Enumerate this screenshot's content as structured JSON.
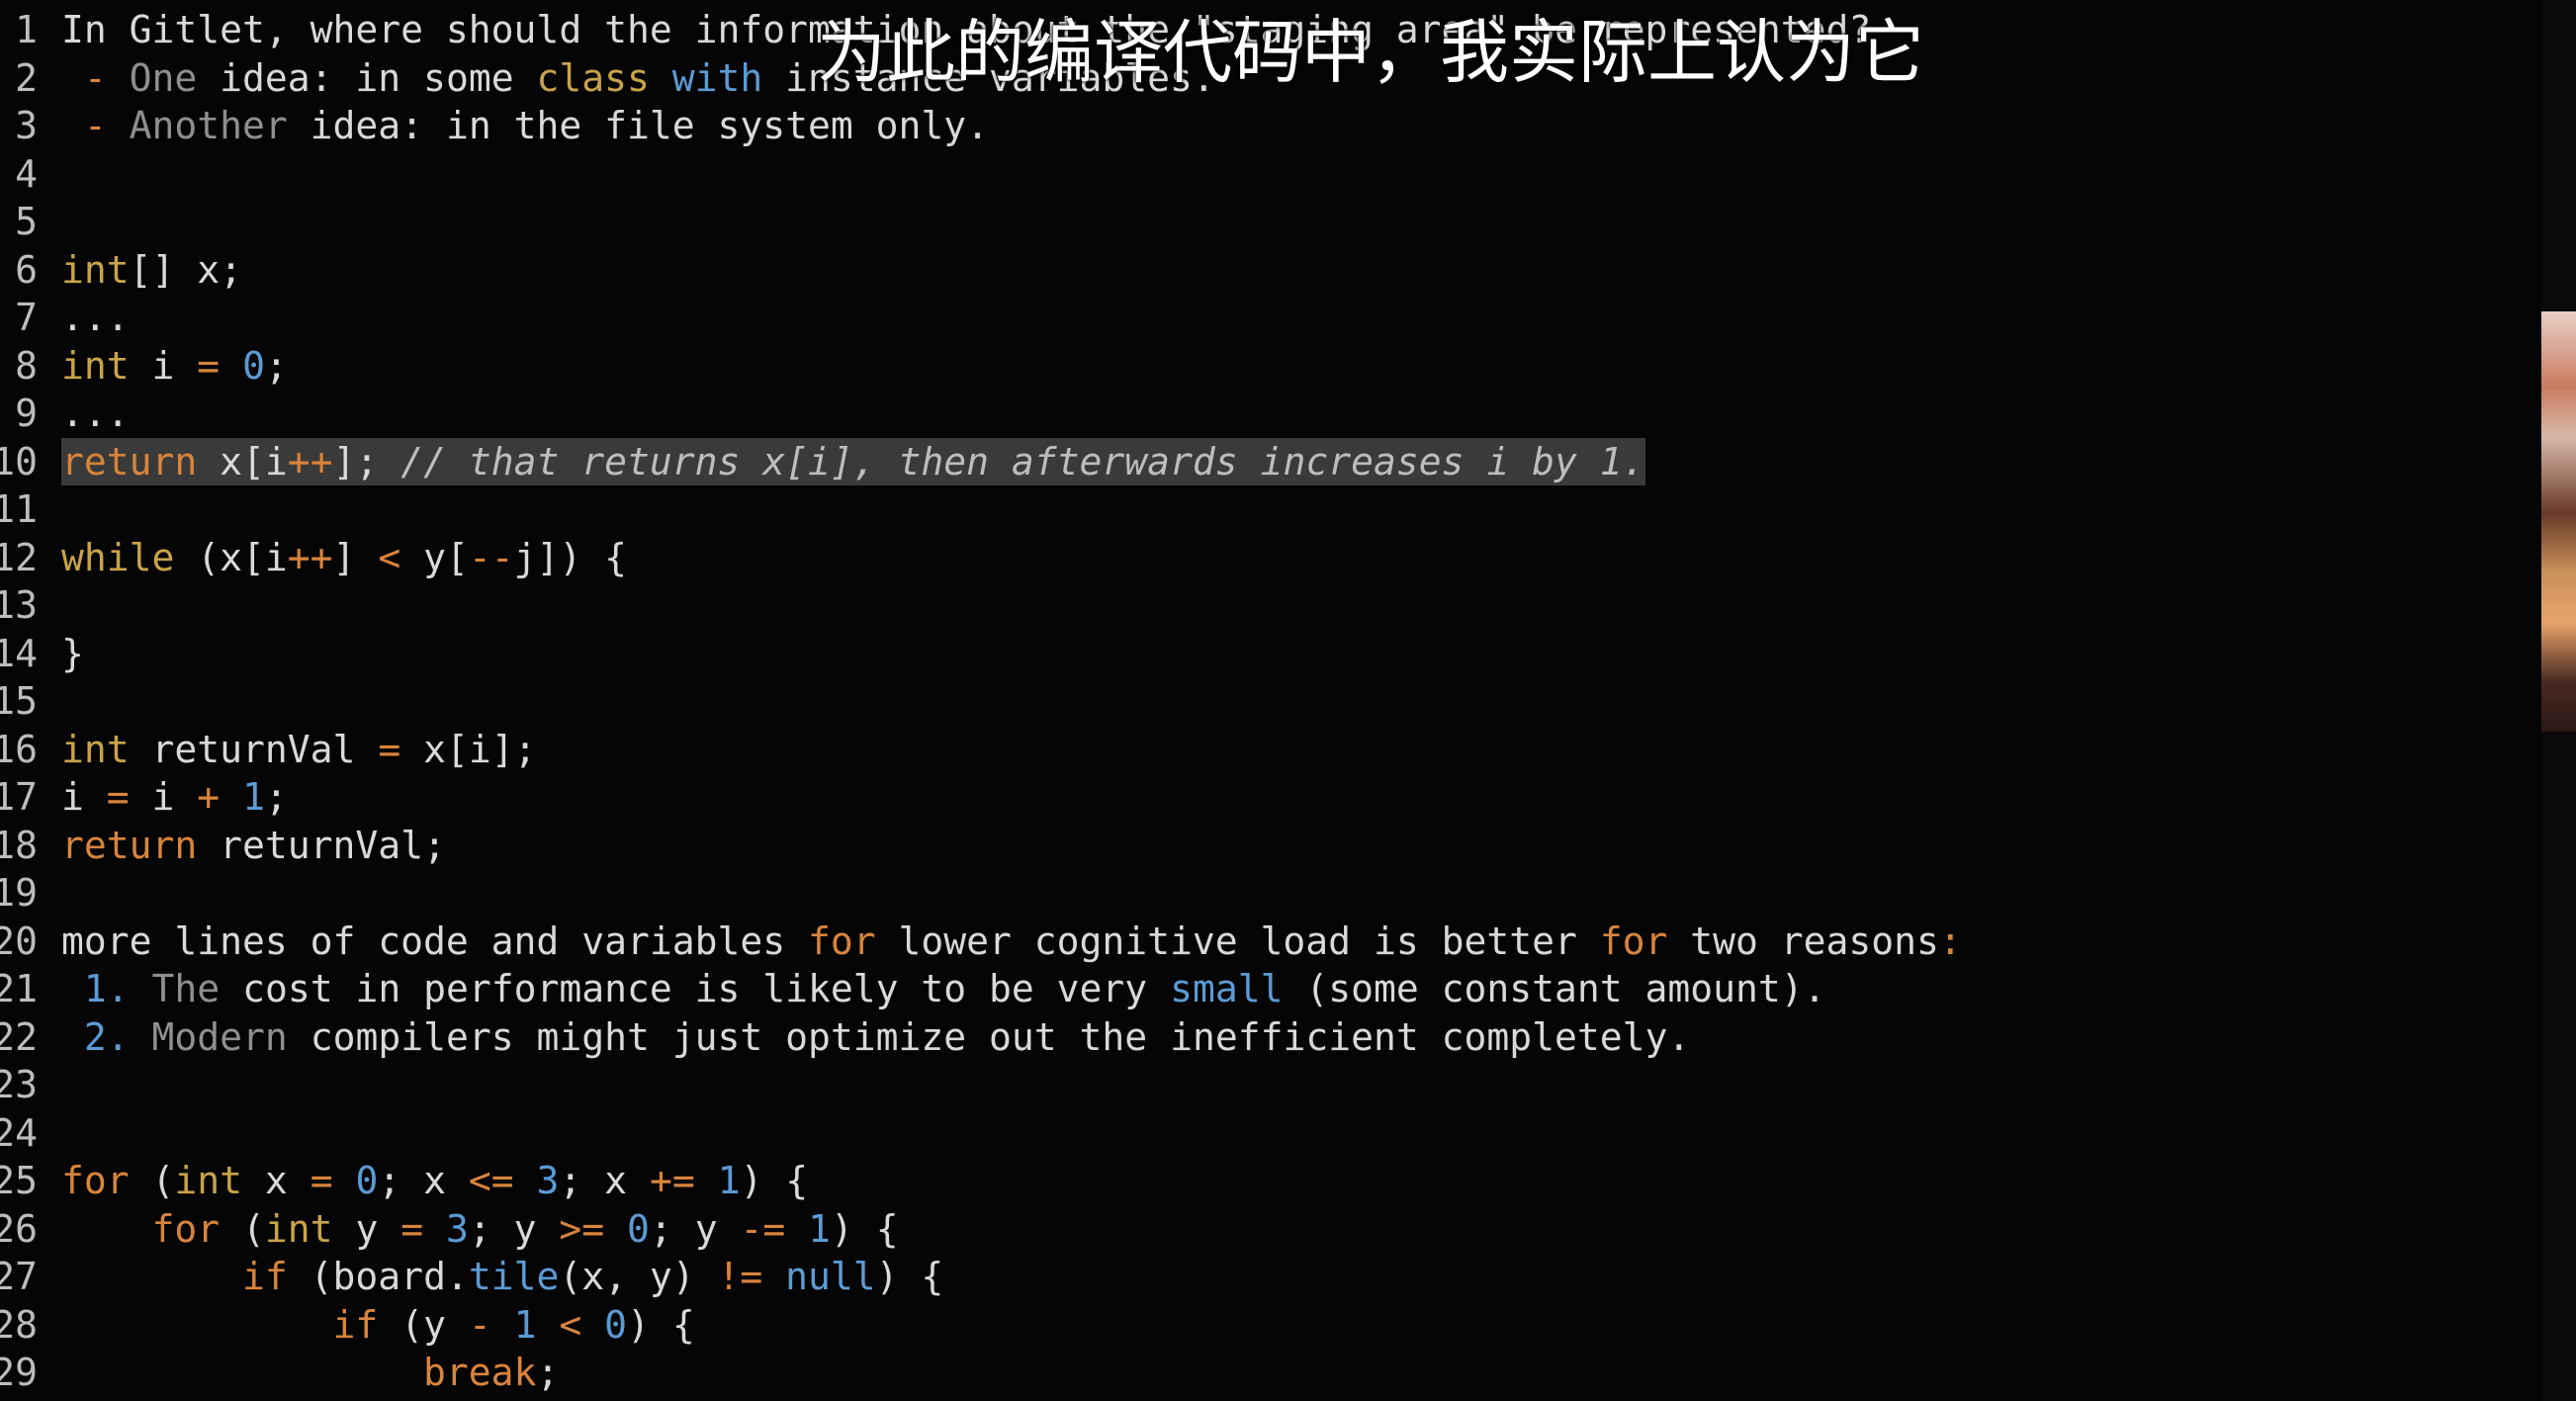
{
  "subtitle": "为此的编译代码中，我实际上认为它",
  "lines": [
    {
      "n": "1",
      "tokens": [
        {
          "t": "In Gitlet, where should the information about the \"staging area\" be represented?",
          "c": "def"
        }
      ]
    },
    {
      "n": "2",
      "tokens": [
        {
          "t": " - ",
          "c": "op"
        },
        {
          "t": "One",
          "c": "dim"
        },
        {
          "t": " idea: in some ",
          "c": "def"
        },
        {
          "t": "class",
          "c": "kw2"
        },
        {
          "t": " ",
          "c": "def"
        },
        {
          "t": "with",
          "c": "blue"
        },
        {
          "t": " instance variables.",
          "c": "def"
        }
      ]
    },
    {
      "n": "3",
      "tokens": [
        {
          "t": " - ",
          "c": "op"
        },
        {
          "t": "Another",
          "c": "dim"
        },
        {
          "t": " idea: in the file system only.",
          "c": "def"
        }
      ]
    },
    {
      "n": "4",
      "tokens": []
    },
    {
      "n": "5",
      "tokens": []
    },
    {
      "n": "6",
      "tokens": [
        {
          "t": "int",
          "c": "kw2"
        },
        {
          "t": "[] x;",
          "c": "def"
        }
      ]
    },
    {
      "n": "7",
      "tokens": [
        {
          "t": "...",
          "c": "def"
        }
      ]
    },
    {
      "n": "8",
      "tokens": [
        {
          "t": "int",
          "c": "kw2"
        },
        {
          "t": " i ",
          "c": "def"
        },
        {
          "t": "=",
          "c": "op"
        },
        {
          "t": " ",
          "c": "def"
        },
        {
          "t": "0",
          "c": "num"
        },
        {
          "t": ";",
          "c": "def"
        }
      ]
    },
    {
      "n": "9",
      "tokens": [
        {
          "t": "...",
          "c": "def"
        }
      ]
    },
    {
      "n": "10",
      "hl": true,
      "tokens": [
        {
          "t": "return",
          "c": "kw"
        },
        {
          "t": " x[i",
          "c": "def"
        },
        {
          "t": "++",
          "c": "op"
        },
        {
          "t": "]; ",
          "c": "def"
        },
        {
          "t": "// that returns x[i], then afterwards increases i by 1.",
          "c": "com"
        }
      ]
    },
    {
      "n": "11",
      "tokens": []
    },
    {
      "n": "12",
      "tokens": [
        {
          "t": "while",
          "c": "kw2"
        },
        {
          "t": " (x[i",
          "c": "def"
        },
        {
          "t": "++",
          "c": "op"
        },
        {
          "t": "] ",
          "c": "def"
        },
        {
          "t": "<",
          "c": "op"
        },
        {
          "t": " y[",
          "c": "def"
        },
        {
          "t": "--",
          "c": "op"
        },
        {
          "t": "j]) {",
          "c": "def"
        }
      ]
    },
    {
      "n": "13",
      "tokens": []
    },
    {
      "n": "14",
      "tokens": [
        {
          "t": "}",
          "c": "def"
        }
      ]
    },
    {
      "n": "15",
      "tokens": []
    },
    {
      "n": "16",
      "tokens": [
        {
          "t": "int",
          "c": "kw2"
        },
        {
          "t": " returnVal ",
          "c": "def"
        },
        {
          "t": "=",
          "c": "op"
        },
        {
          "t": " x[i];",
          "c": "def"
        }
      ]
    },
    {
      "n": "17",
      "tokens": [
        {
          "t": "i ",
          "c": "def"
        },
        {
          "t": "=",
          "c": "op"
        },
        {
          "t": " i ",
          "c": "def"
        },
        {
          "t": "+",
          "c": "op"
        },
        {
          "t": " ",
          "c": "def"
        },
        {
          "t": "1",
          "c": "num"
        },
        {
          "t": ";",
          "c": "def"
        }
      ]
    },
    {
      "n": "18",
      "tokens": [
        {
          "t": "return",
          "c": "kw"
        },
        {
          "t": " returnVal;",
          "c": "def"
        }
      ]
    },
    {
      "n": "19",
      "tokens": []
    },
    {
      "n": "20",
      "tokens": [
        {
          "t": "more lines of code and variables ",
          "c": "def"
        },
        {
          "t": "for",
          "c": "kw"
        },
        {
          "t": " lower cognitive load is better ",
          "c": "def"
        },
        {
          "t": "for",
          "c": "kw"
        },
        {
          "t": " two reasons",
          "c": "def"
        },
        {
          "t": ":",
          "c": "op"
        }
      ]
    },
    {
      "n": "21",
      "tokens": [
        {
          "t": " ",
          "c": "def"
        },
        {
          "t": "1.",
          "c": "num"
        },
        {
          "t": " ",
          "c": "def"
        },
        {
          "t": "The",
          "c": "dim"
        },
        {
          "t": " cost in performance is likely to be very ",
          "c": "def"
        },
        {
          "t": "small",
          "c": "blue"
        },
        {
          "t": " (some constant amount).",
          "c": "def"
        }
      ]
    },
    {
      "n": "22",
      "tokens": [
        {
          "t": " ",
          "c": "def"
        },
        {
          "t": "2.",
          "c": "num"
        },
        {
          "t": " ",
          "c": "def"
        },
        {
          "t": "Modern",
          "c": "dim"
        },
        {
          "t": " compilers might just optimize out the inefficient completely.",
          "c": "def"
        }
      ]
    },
    {
      "n": "23",
      "tokens": []
    },
    {
      "n": "24",
      "tokens": []
    },
    {
      "n": "25",
      "tokens": [
        {
          "t": "for",
          "c": "kw"
        },
        {
          "t": " (",
          "c": "def"
        },
        {
          "t": "int",
          "c": "kw2"
        },
        {
          "t": " x ",
          "c": "def"
        },
        {
          "t": "=",
          "c": "op"
        },
        {
          "t": " ",
          "c": "def"
        },
        {
          "t": "0",
          "c": "num"
        },
        {
          "t": "; x ",
          "c": "def"
        },
        {
          "t": "<=",
          "c": "op"
        },
        {
          "t": " ",
          "c": "def"
        },
        {
          "t": "3",
          "c": "num"
        },
        {
          "t": "; x ",
          "c": "def"
        },
        {
          "t": "+=",
          "c": "op"
        },
        {
          "t": " ",
          "c": "def"
        },
        {
          "t": "1",
          "c": "num"
        },
        {
          "t": ") {",
          "c": "def"
        }
      ]
    },
    {
      "n": "26",
      "tokens": [
        {
          "t": "    ",
          "c": "def"
        },
        {
          "t": "for",
          "c": "kw"
        },
        {
          "t": " (",
          "c": "def"
        },
        {
          "t": "int",
          "c": "kw2"
        },
        {
          "t": " y ",
          "c": "def"
        },
        {
          "t": "=",
          "c": "op"
        },
        {
          "t": " ",
          "c": "def"
        },
        {
          "t": "3",
          "c": "num"
        },
        {
          "t": "; y ",
          "c": "def"
        },
        {
          "t": ">=",
          "c": "op"
        },
        {
          "t": " ",
          "c": "def"
        },
        {
          "t": "0",
          "c": "num"
        },
        {
          "t": "; y ",
          "c": "def"
        },
        {
          "t": "-=",
          "c": "op"
        },
        {
          "t": " ",
          "c": "def"
        },
        {
          "t": "1",
          "c": "num"
        },
        {
          "t": ") {",
          "c": "def"
        }
      ]
    },
    {
      "n": "27",
      "tokens": [
        {
          "t": "        ",
          "c": "def"
        },
        {
          "t": "if",
          "c": "kw"
        },
        {
          "t": " (board.",
          "c": "def"
        },
        {
          "t": "tile",
          "c": "fn"
        },
        {
          "t": "(x, y) ",
          "c": "def"
        },
        {
          "t": "!=",
          "c": "op"
        },
        {
          "t": " ",
          "c": "def"
        },
        {
          "t": "null",
          "c": "blue"
        },
        {
          "t": ") {",
          "c": "def"
        }
      ]
    },
    {
      "n": "28",
      "tokens": [
        {
          "t": "            ",
          "c": "def"
        },
        {
          "t": "if",
          "c": "kw"
        },
        {
          "t": " (y ",
          "c": "def"
        },
        {
          "t": "-",
          "c": "op"
        },
        {
          "t": " ",
          "c": "def"
        },
        {
          "t": "1",
          "c": "num"
        },
        {
          "t": " ",
          "c": "def"
        },
        {
          "t": "<",
          "c": "op"
        },
        {
          "t": " ",
          "c": "def"
        },
        {
          "t": "0",
          "c": "num"
        },
        {
          "t": ") {",
          "c": "def"
        }
      ]
    },
    {
      "n": "29",
      "tokens": [
        {
          "t": "                ",
          "c": "def"
        },
        {
          "t": "break",
          "c": "kw"
        },
        {
          "t": ";",
          "c": "def"
        }
      ]
    }
  ]
}
